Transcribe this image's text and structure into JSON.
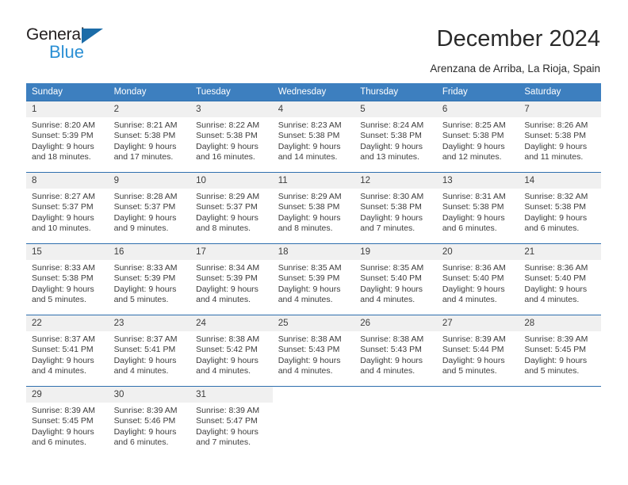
{
  "brand": {
    "name_top": "General",
    "name_bottom": "Blue",
    "triangle_color": "#1b6ca8",
    "blue_color": "#2a8fd4"
  },
  "header": {
    "title": "December 2024",
    "subtitle": "Arenzana de Arriba, La Rioja, Spain"
  },
  "theme": {
    "header_row_bg": "#3d7fbf",
    "header_row_text": "#ffffff",
    "row_divider": "#2f6fae",
    "daynum_bg": "#f0f0f0",
    "body_text": "#3c3c3c"
  },
  "weekdays": [
    "Sunday",
    "Monday",
    "Tuesday",
    "Wednesday",
    "Thursday",
    "Friday",
    "Saturday"
  ],
  "weeks": [
    [
      {
        "day": "1",
        "sunrise": "Sunrise: 8:20 AM",
        "sunset": "Sunset: 5:39 PM",
        "daylight1": "Daylight: 9 hours",
        "daylight2": "and 18 minutes."
      },
      {
        "day": "2",
        "sunrise": "Sunrise: 8:21 AM",
        "sunset": "Sunset: 5:38 PM",
        "daylight1": "Daylight: 9 hours",
        "daylight2": "and 17 minutes."
      },
      {
        "day": "3",
        "sunrise": "Sunrise: 8:22 AM",
        "sunset": "Sunset: 5:38 PM",
        "daylight1": "Daylight: 9 hours",
        "daylight2": "and 16 minutes."
      },
      {
        "day": "4",
        "sunrise": "Sunrise: 8:23 AM",
        "sunset": "Sunset: 5:38 PM",
        "daylight1": "Daylight: 9 hours",
        "daylight2": "and 14 minutes."
      },
      {
        "day": "5",
        "sunrise": "Sunrise: 8:24 AM",
        "sunset": "Sunset: 5:38 PM",
        "daylight1": "Daylight: 9 hours",
        "daylight2": "and 13 minutes."
      },
      {
        "day": "6",
        "sunrise": "Sunrise: 8:25 AM",
        "sunset": "Sunset: 5:38 PM",
        "daylight1": "Daylight: 9 hours",
        "daylight2": "and 12 minutes."
      },
      {
        "day": "7",
        "sunrise": "Sunrise: 8:26 AM",
        "sunset": "Sunset: 5:38 PM",
        "daylight1": "Daylight: 9 hours",
        "daylight2": "and 11 minutes."
      }
    ],
    [
      {
        "day": "8",
        "sunrise": "Sunrise: 8:27 AM",
        "sunset": "Sunset: 5:37 PM",
        "daylight1": "Daylight: 9 hours",
        "daylight2": "and 10 minutes."
      },
      {
        "day": "9",
        "sunrise": "Sunrise: 8:28 AM",
        "sunset": "Sunset: 5:37 PM",
        "daylight1": "Daylight: 9 hours",
        "daylight2": "and 9 minutes."
      },
      {
        "day": "10",
        "sunrise": "Sunrise: 8:29 AM",
        "sunset": "Sunset: 5:37 PM",
        "daylight1": "Daylight: 9 hours",
        "daylight2": "and 8 minutes."
      },
      {
        "day": "11",
        "sunrise": "Sunrise: 8:29 AM",
        "sunset": "Sunset: 5:38 PM",
        "daylight1": "Daylight: 9 hours",
        "daylight2": "and 8 minutes."
      },
      {
        "day": "12",
        "sunrise": "Sunrise: 8:30 AM",
        "sunset": "Sunset: 5:38 PM",
        "daylight1": "Daylight: 9 hours",
        "daylight2": "and 7 minutes."
      },
      {
        "day": "13",
        "sunrise": "Sunrise: 8:31 AM",
        "sunset": "Sunset: 5:38 PM",
        "daylight1": "Daylight: 9 hours",
        "daylight2": "and 6 minutes."
      },
      {
        "day": "14",
        "sunrise": "Sunrise: 8:32 AM",
        "sunset": "Sunset: 5:38 PM",
        "daylight1": "Daylight: 9 hours",
        "daylight2": "and 6 minutes."
      }
    ],
    [
      {
        "day": "15",
        "sunrise": "Sunrise: 8:33 AM",
        "sunset": "Sunset: 5:38 PM",
        "daylight1": "Daylight: 9 hours",
        "daylight2": "and 5 minutes."
      },
      {
        "day": "16",
        "sunrise": "Sunrise: 8:33 AM",
        "sunset": "Sunset: 5:39 PM",
        "daylight1": "Daylight: 9 hours",
        "daylight2": "and 5 minutes."
      },
      {
        "day": "17",
        "sunrise": "Sunrise: 8:34 AM",
        "sunset": "Sunset: 5:39 PM",
        "daylight1": "Daylight: 9 hours",
        "daylight2": "and 4 minutes."
      },
      {
        "day": "18",
        "sunrise": "Sunrise: 8:35 AM",
        "sunset": "Sunset: 5:39 PM",
        "daylight1": "Daylight: 9 hours",
        "daylight2": "and 4 minutes."
      },
      {
        "day": "19",
        "sunrise": "Sunrise: 8:35 AM",
        "sunset": "Sunset: 5:40 PM",
        "daylight1": "Daylight: 9 hours",
        "daylight2": "and 4 minutes."
      },
      {
        "day": "20",
        "sunrise": "Sunrise: 8:36 AM",
        "sunset": "Sunset: 5:40 PM",
        "daylight1": "Daylight: 9 hours",
        "daylight2": "and 4 minutes."
      },
      {
        "day": "21",
        "sunrise": "Sunrise: 8:36 AM",
        "sunset": "Sunset: 5:40 PM",
        "daylight1": "Daylight: 9 hours",
        "daylight2": "and 4 minutes."
      }
    ],
    [
      {
        "day": "22",
        "sunrise": "Sunrise: 8:37 AM",
        "sunset": "Sunset: 5:41 PM",
        "daylight1": "Daylight: 9 hours",
        "daylight2": "and 4 minutes."
      },
      {
        "day": "23",
        "sunrise": "Sunrise: 8:37 AM",
        "sunset": "Sunset: 5:41 PM",
        "daylight1": "Daylight: 9 hours",
        "daylight2": "and 4 minutes."
      },
      {
        "day": "24",
        "sunrise": "Sunrise: 8:38 AM",
        "sunset": "Sunset: 5:42 PM",
        "daylight1": "Daylight: 9 hours",
        "daylight2": "and 4 minutes."
      },
      {
        "day": "25",
        "sunrise": "Sunrise: 8:38 AM",
        "sunset": "Sunset: 5:43 PM",
        "daylight1": "Daylight: 9 hours",
        "daylight2": "and 4 minutes."
      },
      {
        "day": "26",
        "sunrise": "Sunrise: 8:38 AM",
        "sunset": "Sunset: 5:43 PM",
        "daylight1": "Daylight: 9 hours",
        "daylight2": "and 4 minutes."
      },
      {
        "day": "27",
        "sunrise": "Sunrise: 8:39 AM",
        "sunset": "Sunset: 5:44 PM",
        "daylight1": "Daylight: 9 hours",
        "daylight2": "and 5 minutes."
      },
      {
        "day": "28",
        "sunrise": "Sunrise: 8:39 AM",
        "sunset": "Sunset: 5:45 PM",
        "daylight1": "Daylight: 9 hours",
        "daylight2": "and 5 minutes."
      }
    ],
    [
      {
        "day": "29",
        "sunrise": "Sunrise: 8:39 AM",
        "sunset": "Sunset: 5:45 PM",
        "daylight1": "Daylight: 9 hours",
        "daylight2": "and 6 minutes."
      },
      {
        "day": "30",
        "sunrise": "Sunrise: 8:39 AM",
        "sunset": "Sunset: 5:46 PM",
        "daylight1": "Daylight: 9 hours",
        "daylight2": "and 6 minutes."
      },
      {
        "day": "31",
        "sunrise": "Sunrise: 8:39 AM",
        "sunset": "Sunset: 5:47 PM",
        "daylight1": "Daylight: 9 hours",
        "daylight2": "and 7 minutes."
      },
      {
        "day": "",
        "sunrise": "",
        "sunset": "",
        "daylight1": "",
        "daylight2": ""
      },
      {
        "day": "",
        "sunrise": "",
        "sunset": "",
        "daylight1": "",
        "daylight2": ""
      },
      {
        "day": "",
        "sunrise": "",
        "sunset": "",
        "daylight1": "",
        "daylight2": ""
      },
      {
        "day": "",
        "sunrise": "",
        "sunset": "",
        "daylight1": "",
        "daylight2": ""
      }
    ]
  ]
}
